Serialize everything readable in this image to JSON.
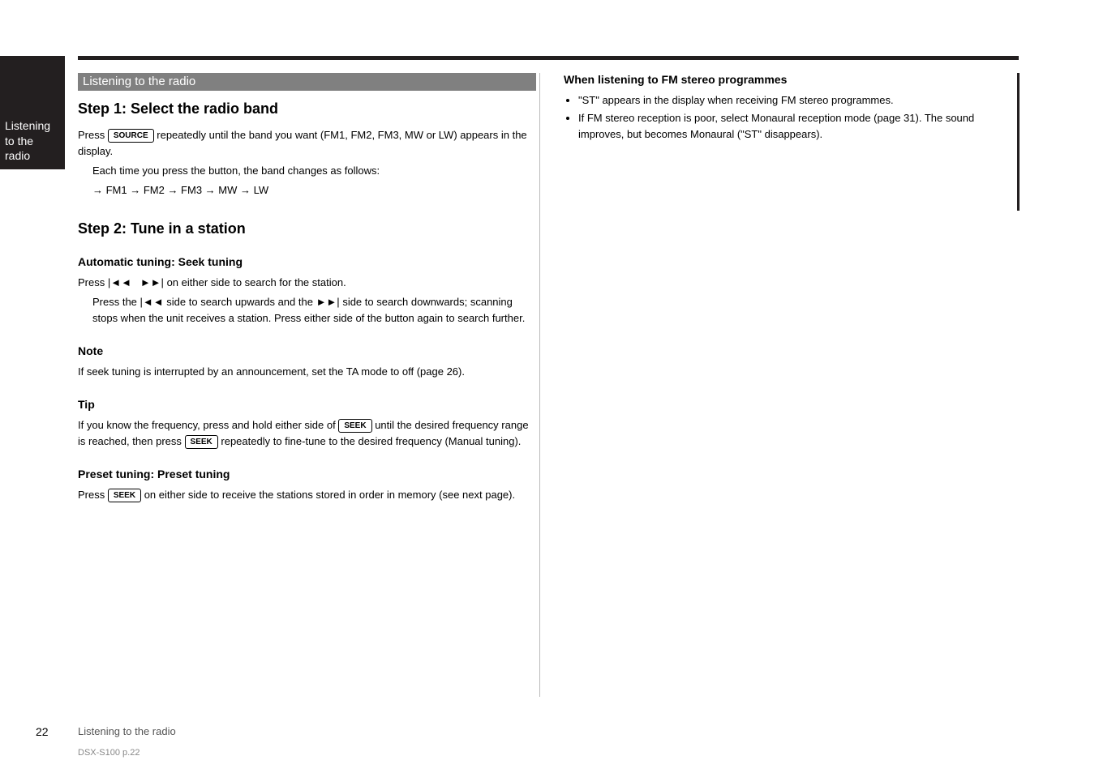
{
  "sideTab": {
    "line1": "Listening to the",
    "line2": "radio"
  },
  "sectionBar": "Listening to the radio",
  "buttons": {
    "source": "SOURCE",
    "seek": "SEEK"
  },
  "left": {
    "step1": {
      "title": "Step 1: Select the radio band",
      "p1a": "Press ",
      "p1b": " repeatedly until the band you want (FM1, FM2, FM3, MW or LW) appears in the display.",
      "p2": "Each time you press the button, the band changes as follows:",
      "p3": "→ FM1 → FM2 → FM3 → MW → LW"
    },
    "step2": {
      "title": "Step 2: Tune in a station",
      "auto": {
        "heading": "Automatic tuning: Seek tuning",
        "p1a": "Press ",
        "p1b": " on either side to search for the station.",
        "indented": "Press the ",
        "indented_mid": " side to search upwards and the ",
        "indented_tail": " side to search downwards; scanning stops when the unit receives a station. Press either side of the button again to search further."
      },
      "note": {
        "heading": "Note",
        "text": "If seek tuning is interrupted by an announcement, set the TA mode to off (page 26)."
      },
      "tip": {
        "heading": "Tip",
        "text_a": "If you know the frequency, press and hold either side of ",
        "text_b": " until the desired frequency range is reached, then press ",
        "text_c": " repeatedly to fine-tune to the desired frequency (Manual tuning)."
      },
      "preset": {
        "heading": "Preset tuning: Preset tuning",
        "text_a": "Press ",
        "text_b": " on either side to receive the stations stored in order in memory (see next page)."
      }
    }
  },
  "right": {
    "heading": "When listening to FM stereo programmes",
    "bullets": [
      "\"ST\" appears in the display when receiving FM stereo programmes.",
      "If FM stereo reception is poor, select Monaural reception mode (page 31). The sound improves, but becomes Monaural (\"ST\" disappears)."
    ]
  },
  "pageNum": "22",
  "footer": "Listening to the radio",
  "docId": "DSX-S100  p.22"
}
